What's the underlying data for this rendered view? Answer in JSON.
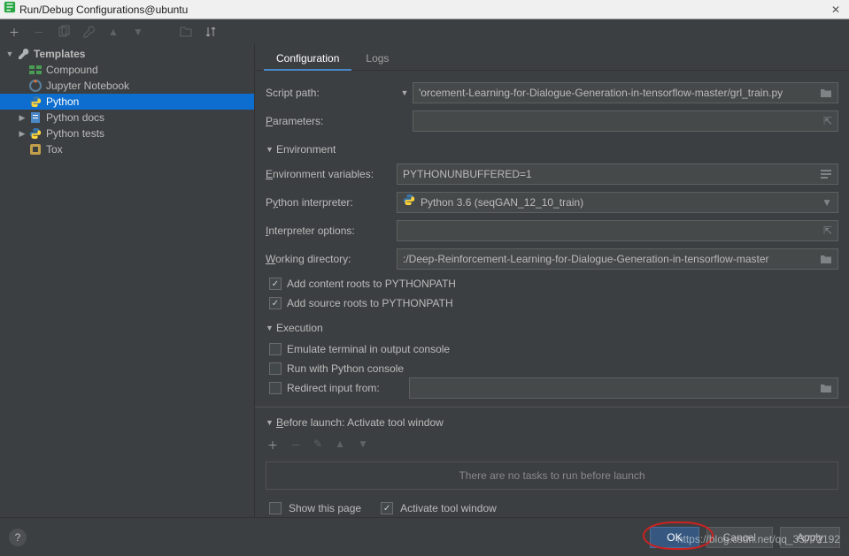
{
  "window": {
    "title": "Run/Debug Configurations@ubuntu"
  },
  "toolbar_icons": [
    "plus",
    "minus",
    "copy",
    "wrench",
    "up",
    "down",
    "spacer",
    "folder-tree",
    "sort"
  ],
  "tree": {
    "root": {
      "label": "Templates"
    },
    "items": [
      {
        "label": "Compound",
        "icon": "compound"
      },
      {
        "label": "Jupyter Notebook",
        "icon": "jupyter"
      },
      {
        "label": "Python",
        "icon": "python",
        "selected": true
      },
      {
        "label": "Python docs",
        "icon": "docs",
        "expandable": true
      },
      {
        "label": "Python tests",
        "icon": "python",
        "expandable": true
      },
      {
        "label": "Tox",
        "icon": "tox"
      }
    ]
  },
  "tabs": [
    {
      "label": "Configuration",
      "active": true
    },
    {
      "label": "Logs",
      "active": false
    }
  ],
  "form": {
    "script_path": {
      "label": "Script path:",
      "value": "'orcement-Learning-for-Dialogue-Generation-in-tensorflow-master/grl_train.py"
    },
    "parameters": {
      "label": "Parameters:",
      "value": ""
    },
    "env_section": "Environment",
    "env_vars": {
      "label": "Environment variables:",
      "value": "PYTHONUNBUFFERED=1"
    },
    "interpreter": {
      "label": "Python interpreter:",
      "value": "Python 3.6 (seqGAN_12_10_train)"
    },
    "interp_opts": {
      "label": "Interpreter options:",
      "value": ""
    },
    "working_dir": {
      "label": "Working directory:",
      "value": ":/Deep-Reinforcement-Learning-for-Dialogue-Generation-in-tensorflow-master"
    },
    "add_content_roots": {
      "label": "Add content roots to PYTHONPATH",
      "checked": true
    },
    "add_source_roots": {
      "label": "Add source roots to PYTHONPATH",
      "checked": true
    },
    "exec_section": "Execution",
    "emulate_terminal": {
      "label": "Emulate terminal in output console",
      "checked": false
    },
    "run_py_console": {
      "label": "Run with Python console",
      "checked": false
    },
    "redirect_input": {
      "label": "Redirect input from:",
      "checked": false,
      "value": ""
    },
    "before_section": "Before launch: Activate tool window",
    "before_empty": "There are no tasks to run before launch",
    "show_this_page": {
      "label": "Show this page",
      "checked": false
    },
    "activate_tool": {
      "label": "Activate tool window",
      "checked": true
    }
  },
  "buttons": {
    "ok": "OK",
    "cancel": "Cancel",
    "apply": "Apply"
  },
  "watermark": "https://blog.csdn.net/qq_33772192"
}
